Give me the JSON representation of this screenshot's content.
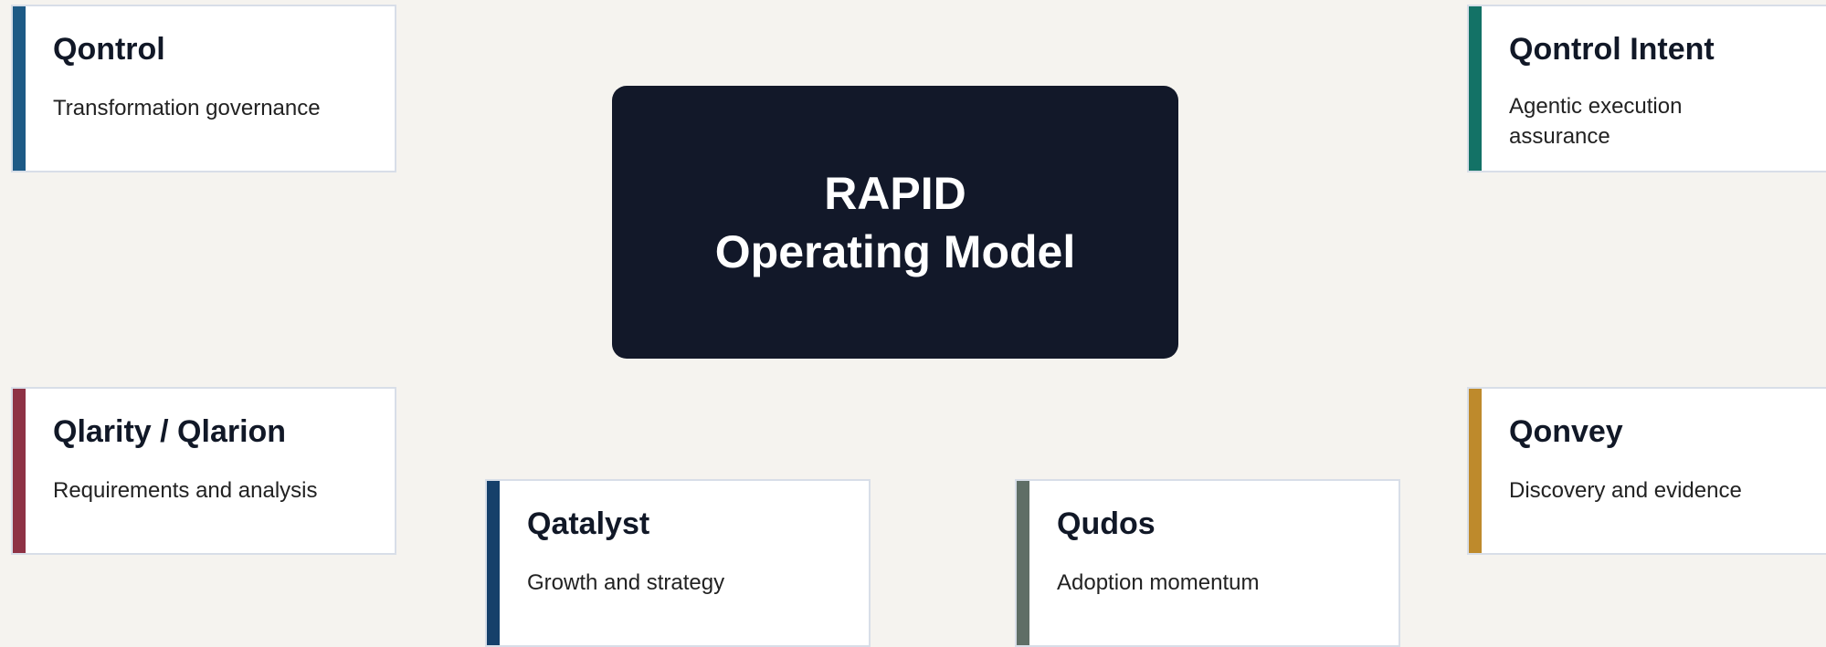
{
  "center": {
    "line1": "RAPID",
    "line2": "Operating Model",
    "background": "#121829"
  },
  "cards": [
    {
      "title": "Qontrol",
      "subtitle": "Transformation governance",
      "accent": "#1d5a86"
    },
    {
      "title": "Qontrol Intent",
      "subtitle": "Agentic execution assurance",
      "accent": "#137266"
    },
    {
      "title": "Qlarity / Qlarion",
      "subtitle": "Requirements and analysis",
      "accent": "#8e3245"
    },
    {
      "title": "Qonvey",
      "subtitle": "Discovery and evidence",
      "accent": "#be8a2c"
    },
    {
      "title": "Qatalyst",
      "subtitle": "Growth and strategy",
      "accent": "#16406a"
    },
    {
      "title": "Qudos",
      "subtitle": "Adoption momentum",
      "accent": "#5f6e66"
    }
  ]
}
